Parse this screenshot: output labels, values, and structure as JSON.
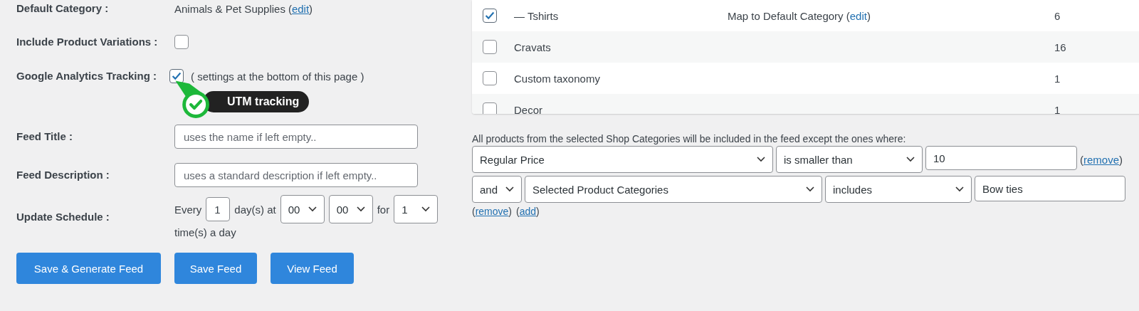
{
  "settings": {
    "default_category": {
      "label": "Default Category :",
      "value": "Animals & Pet Supplies",
      "link": {
        "before": "(",
        "text": "edit",
        "after": ")"
      }
    },
    "include_variations": {
      "label": "Include Product Variations :",
      "checked": false
    },
    "analytics": {
      "label": "Google Analytics Tracking :",
      "checked": true,
      "note": "( settings at the bottom of this page )",
      "badge": "UTM tracking"
    },
    "feed_title": {
      "label": "Feed Title :",
      "placeholder": "uses the name if left empty.."
    },
    "feed_description": {
      "label": "Feed Description :",
      "placeholder": "uses a standard description if left empty.."
    },
    "schedule": {
      "label": "Update Schedule :",
      "every": "Every",
      "days": "1",
      "days_text": "day(s) at",
      "hour": "00",
      "minute": "00",
      "for_text": "for",
      "times": "1",
      "times_text": "time(s) a day"
    },
    "buttons": [
      "Save & Generate Feed",
      "Save Feed",
      "View Feed"
    ]
  },
  "categories": [
    {
      "name": "— Tshirts",
      "checked": true,
      "mapping": "Map to Default Category",
      "mapping_link": {
        "before": "(",
        "text": "edit",
        "after": ")"
      },
      "count": "6"
    },
    {
      "name": "Cravats",
      "checked": false,
      "count": "16"
    },
    {
      "name": "Custom taxonomy",
      "checked": false,
      "count": "1"
    },
    {
      "name": "Decor",
      "checked": false,
      "count": "1"
    }
  ],
  "filters": {
    "intro": "All products from the selected Shop Categories will be included in the feed except the ones where:",
    "rows": [
      {
        "field": "Regular Price",
        "operator": "is smaller than",
        "value": "10",
        "link": {
          "before": "(",
          "text": "remove",
          "after": ")"
        }
      },
      {
        "connector": "and",
        "field": "Selected Product Categories",
        "operator": "includes",
        "value": "Bow ties"
      }
    ],
    "links": [
      {
        "before": "(",
        "text": "remove",
        "after": ")"
      },
      {
        "before": "(",
        "text": "add",
        "after": ")"
      }
    ]
  }
}
